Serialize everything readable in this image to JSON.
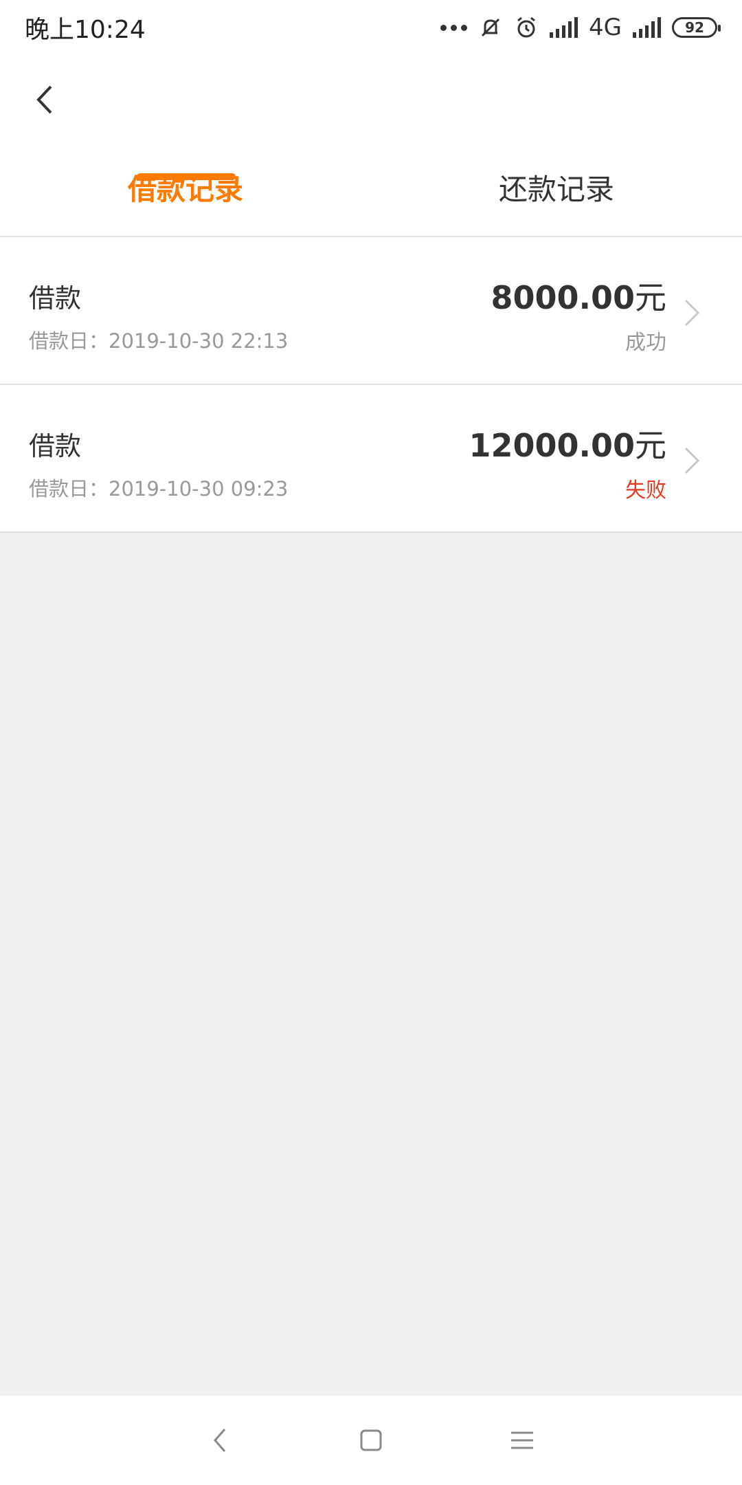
{
  "status_bar": {
    "time": "晚上10:24",
    "network": "4G",
    "battery": "92",
    "icons": [
      "more-dots-icon",
      "mute-icon",
      "alarm-icon",
      "signal-icon",
      "signal-icon"
    ]
  },
  "header": {
    "back_icon": "chevron-left-icon",
    "tabs": [
      {
        "label": "借款记录",
        "active": true
      },
      {
        "label": "还款记录",
        "active": false
      }
    ]
  },
  "records": [
    {
      "title": "借款",
      "date": "借款日：2019-10-30 22:13",
      "amount": "8000.00",
      "unit": "元",
      "status": "成功"
    },
    {
      "title": "借款",
      "date": "借款日：2019-10-30 09:23",
      "amount": "12000.00",
      "unit": "元",
      "status": "失败"
    }
  ],
  "colors": {
    "accent": "#ff7a00",
    "fail": "#e43a1f",
    "muted": "#999999",
    "text": "#333333",
    "background": "#f0f0f0"
  },
  "nav_bar": {
    "icons": [
      "back-triangle-icon",
      "home-square-icon",
      "menu-lines-icon"
    ]
  }
}
